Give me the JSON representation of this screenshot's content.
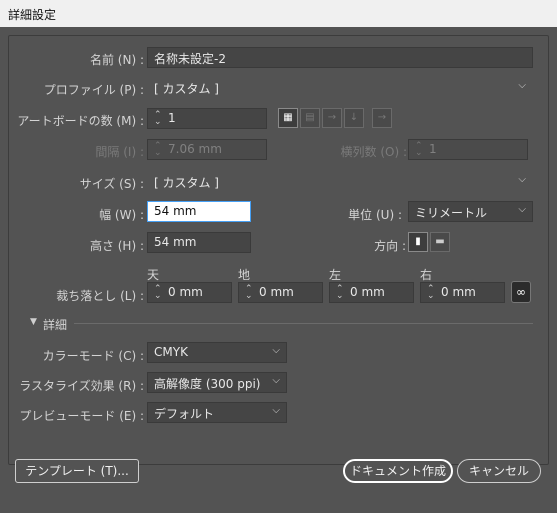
{
  "window": {
    "title": "詳細設定"
  },
  "fields": {
    "name_label": "名前 (N) :",
    "name_value": "名称未設定-2",
    "profile_label": "プロファイル (P) :",
    "profile_value": "[ カスタム ]",
    "artboards_label": "アートボードの数 (M) :",
    "artboards_value": "1",
    "spacing_label": "間隔 (I) :",
    "spacing_value": "7.06 mm",
    "columns_label": "横列数 (O) :",
    "columns_value": "1",
    "size_label": "サイズ (S) :",
    "size_value": "[ カスタム ]",
    "width_label": "幅 (W) :",
    "width_value": "54 mm",
    "units_label": "単位 (U) :",
    "units_value": "ミリメートル",
    "height_label": "高さ (H) :",
    "height_value": "54 mm",
    "orientation_label": "方向 :"
  },
  "bleed": {
    "label": "裁ち落とし (L) :",
    "top_label": "天",
    "bottom_label": "地",
    "left_label": "左",
    "right_label": "右",
    "top_value": "0 mm",
    "bottom_value": "0 mm",
    "left_value": "0 mm",
    "right_value": "0 mm"
  },
  "advanced": {
    "header": "詳細",
    "color_mode_label": "カラーモード (C) :",
    "color_mode_value": "CMYK",
    "raster_label": "ラスタライズ効果 (R) :",
    "raster_value": "高解像度 (300 ppi)",
    "preview_label": "プレビューモード (E) :",
    "preview_value": "デフォルト"
  },
  "buttons": {
    "templates": "テンプレート (T)...",
    "create": "ドキュメント作成",
    "cancel": "キャンセル"
  },
  "icons": {
    "spinner": "spinner-arrows-icon",
    "chevron": "chevron-down-icon",
    "triangle": "disclosure-triangle-icon",
    "link": "link-chain-icon"
  }
}
